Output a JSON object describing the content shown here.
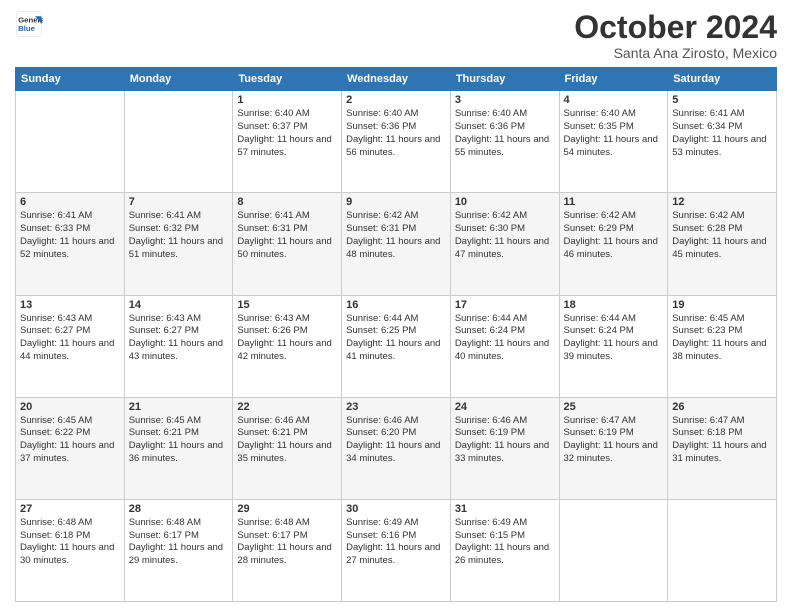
{
  "header": {
    "logo_line1": "General",
    "logo_line2": "Blue",
    "month": "October 2024",
    "location": "Santa Ana Zirosto, Mexico"
  },
  "weekdays": [
    "Sunday",
    "Monday",
    "Tuesday",
    "Wednesday",
    "Thursday",
    "Friday",
    "Saturday"
  ],
  "weeks": [
    [
      {
        "day": "",
        "info": ""
      },
      {
        "day": "",
        "info": ""
      },
      {
        "day": "1",
        "info": "Sunrise: 6:40 AM\nSunset: 6:37 PM\nDaylight: 11 hours and 57 minutes."
      },
      {
        "day": "2",
        "info": "Sunrise: 6:40 AM\nSunset: 6:36 PM\nDaylight: 11 hours and 56 minutes."
      },
      {
        "day": "3",
        "info": "Sunrise: 6:40 AM\nSunset: 6:36 PM\nDaylight: 11 hours and 55 minutes."
      },
      {
        "day": "4",
        "info": "Sunrise: 6:40 AM\nSunset: 6:35 PM\nDaylight: 11 hours and 54 minutes."
      },
      {
        "day": "5",
        "info": "Sunrise: 6:41 AM\nSunset: 6:34 PM\nDaylight: 11 hours and 53 minutes."
      }
    ],
    [
      {
        "day": "6",
        "info": "Sunrise: 6:41 AM\nSunset: 6:33 PM\nDaylight: 11 hours and 52 minutes."
      },
      {
        "day": "7",
        "info": "Sunrise: 6:41 AM\nSunset: 6:32 PM\nDaylight: 11 hours and 51 minutes."
      },
      {
        "day": "8",
        "info": "Sunrise: 6:41 AM\nSunset: 6:31 PM\nDaylight: 11 hours and 50 minutes."
      },
      {
        "day": "9",
        "info": "Sunrise: 6:42 AM\nSunset: 6:31 PM\nDaylight: 11 hours and 48 minutes."
      },
      {
        "day": "10",
        "info": "Sunrise: 6:42 AM\nSunset: 6:30 PM\nDaylight: 11 hours and 47 minutes."
      },
      {
        "day": "11",
        "info": "Sunrise: 6:42 AM\nSunset: 6:29 PM\nDaylight: 11 hours and 46 minutes."
      },
      {
        "day": "12",
        "info": "Sunrise: 6:42 AM\nSunset: 6:28 PM\nDaylight: 11 hours and 45 minutes."
      }
    ],
    [
      {
        "day": "13",
        "info": "Sunrise: 6:43 AM\nSunset: 6:27 PM\nDaylight: 11 hours and 44 minutes."
      },
      {
        "day": "14",
        "info": "Sunrise: 6:43 AM\nSunset: 6:27 PM\nDaylight: 11 hours and 43 minutes."
      },
      {
        "day": "15",
        "info": "Sunrise: 6:43 AM\nSunset: 6:26 PM\nDaylight: 11 hours and 42 minutes."
      },
      {
        "day": "16",
        "info": "Sunrise: 6:44 AM\nSunset: 6:25 PM\nDaylight: 11 hours and 41 minutes."
      },
      {
        "day": "17",
        "info": "Sunrise: 6:44 AM\nSunset: 6:24 PM\nDaylight: 11 hours and 40 minutes."
      },
      {
        "day": "18",
        "info": "Sunrise: 6:44 AM\nSunset: 6:24 PM\nDaylight: 11 hours and 39 minutes."
      },
      {
        "day": "19",
        "info": "Sunrise: 6:45 AM\nSunset: 6:23 PM\nDaylight: 11 hours and 38 minutes."
      }
    ],
    [
      {
        "day": "20",
        "info": "Sunrise: 6:45 AM\nSunset: 6:22 PM\nDaylight: 11 hours and 37 minutes."
      },
      {
        "day": "21",
        "info": "Sunrise: 6:45 AM\nSunset: 6:21 PM\nDaylight: 11 hours and 36 minutes."
      },
      {
        "day": "22",
        "info": "Sunrise: 6:46 AM\nSunset: 6:21 PM\nDaylight: 11 hours and 35 minutes."
      },
      {
        "day": "23",
        "info": "Sunrise: 6:46 AM\nSunset: 6:20 PM\nDaylight: 11 hours and 34 minutes."
      },
      {
        "day": "24",
        "info": "Sunrise: 6:46 AM\nSunset: 6:19 PM\nDaylight: 11 hours and 33 minutes."
      },
      {
        "day": "25",
        "info": "Sunrise: 6:47 AM\nSunset: 6:19 PM\nDaylight: 11 hours and 32 minutes."
      },
      {
        "day": "26",
        "info": "Sunrise: 6:47 AM\nSunset: 6:18 PM\nDaylight: 11 hours and 31 minutes."
      }
    ],
    [
      {
        "day": "27",
        "info": "Sunrise: 6:48 AM\nSunset: 6:18 PM\nDaylight: 11 hours and 30 minutes."
      },
      {
        "day": "28",
        "info": "Sunrise: 6:48 AM\nSunset: 6:17 PM\nDaylight: 11 hours and 29 minutes."
      },
      {
        "day": "29",
        "info": "Sunrise: 6:48 AM\nSunset: 6:17 PM\nDaylight: 11 hours and 28 minutes."
      },
      {
        "day": "30",
        "info": "Sunrise: 6:49 AM\nSunset: 6:16 PM\nDaylight: 11 hours and 27 minutes."
      },
      {
        "day": "31",
        "info": "Sunrise: 6:49 AM\nSunset: 6:15 PM\nDaylight: 11 hours and 26 minutes."
      },
      {
        "day": "",
        "info": ""
      },
      {
        "day": "",
        "info": ""
      }
    ]
  ]
}
